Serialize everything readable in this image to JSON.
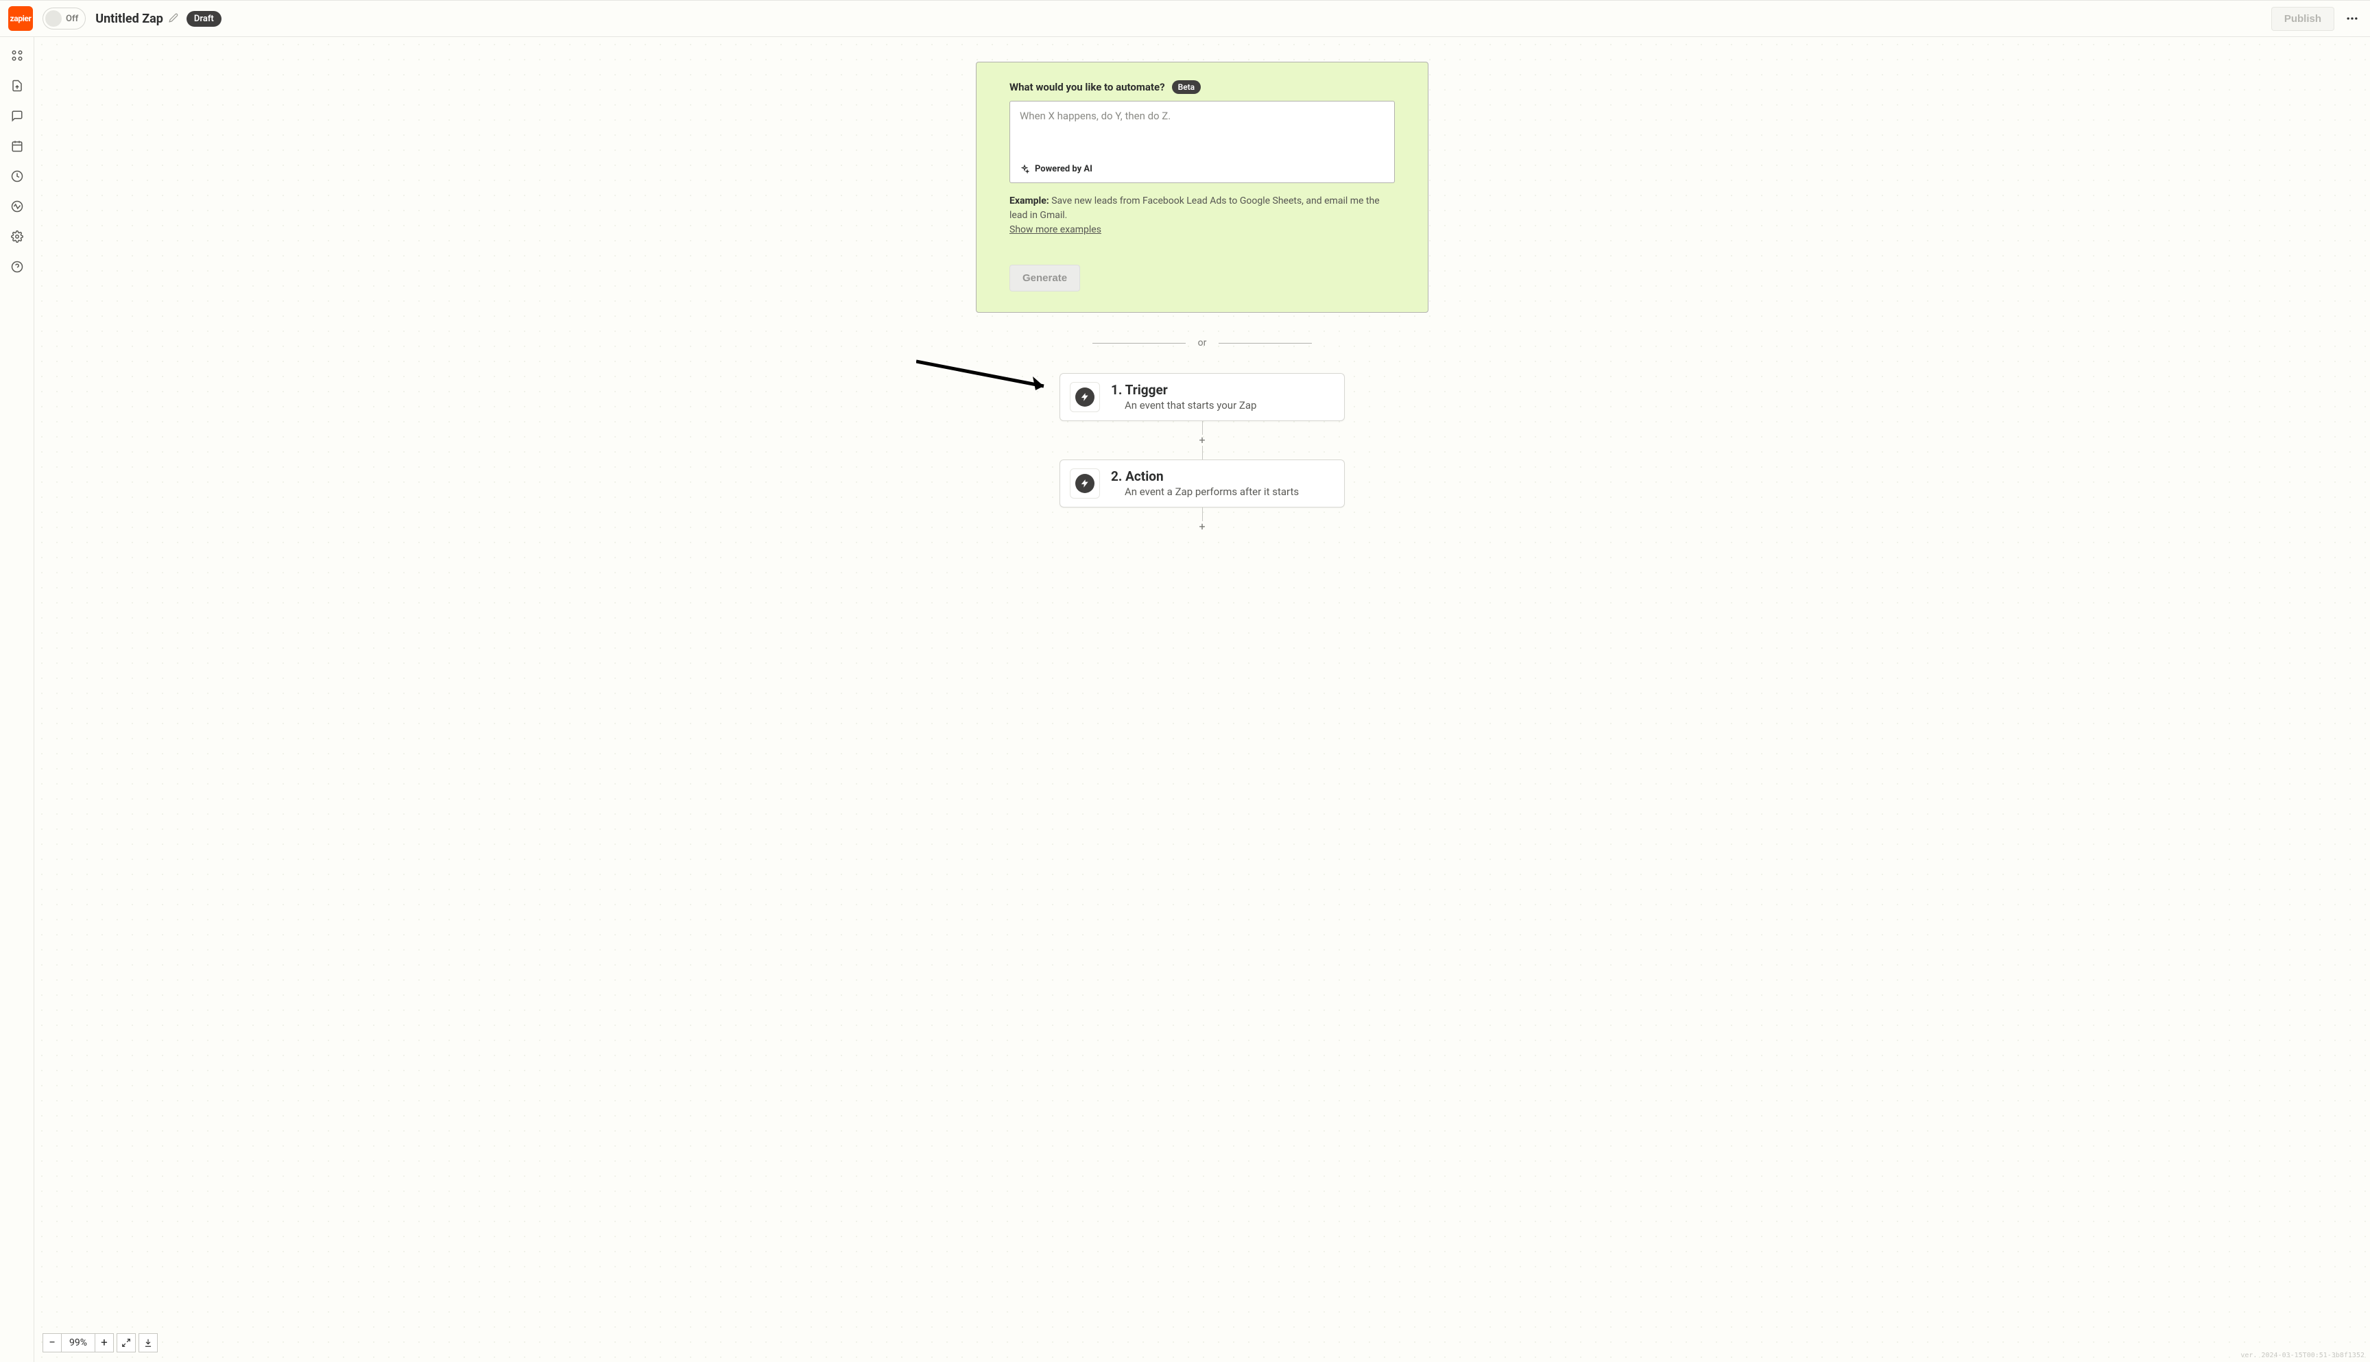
{
  "header": {
    "logo_text": "zapier",
    "toggle_label": "Off",
    "zap_title": "Untitled Zap",
    "draft_badge": "Draft",
    "publish_label": "Publish"
  },
  "ai_box": {
    "title": "What would you like to automate?",
    "beta_badge": "Beta",
    "placeholder": "When X happens, do Y, then do Z.",
    "powered_label": "Powered by AI",
    "example_label": "Example:",
    "example_text": "Save new leads from Facebook Lead Ads to Google Sheets, and email me the lead in Gmail.",
    "show_more": "Show more examples",
    "generate_label": "Generate"
  },
  "divider": {
    "or": "or"
  },
  "steps": {
    "trigger": {
      "title": "1. Trigger",
      "desc": "An event that starts your Zap"
    },
    "action": {
      "title": "2. Action",
      "desc": "An event a Zap performs after it starts"
    }
  },
  "zoom": {
    "minus": "−",
    "value": "99%",
    "plus": "+"
  },
  "version": "ver. 2024-03-15T00:51-3b8f1352"
}
